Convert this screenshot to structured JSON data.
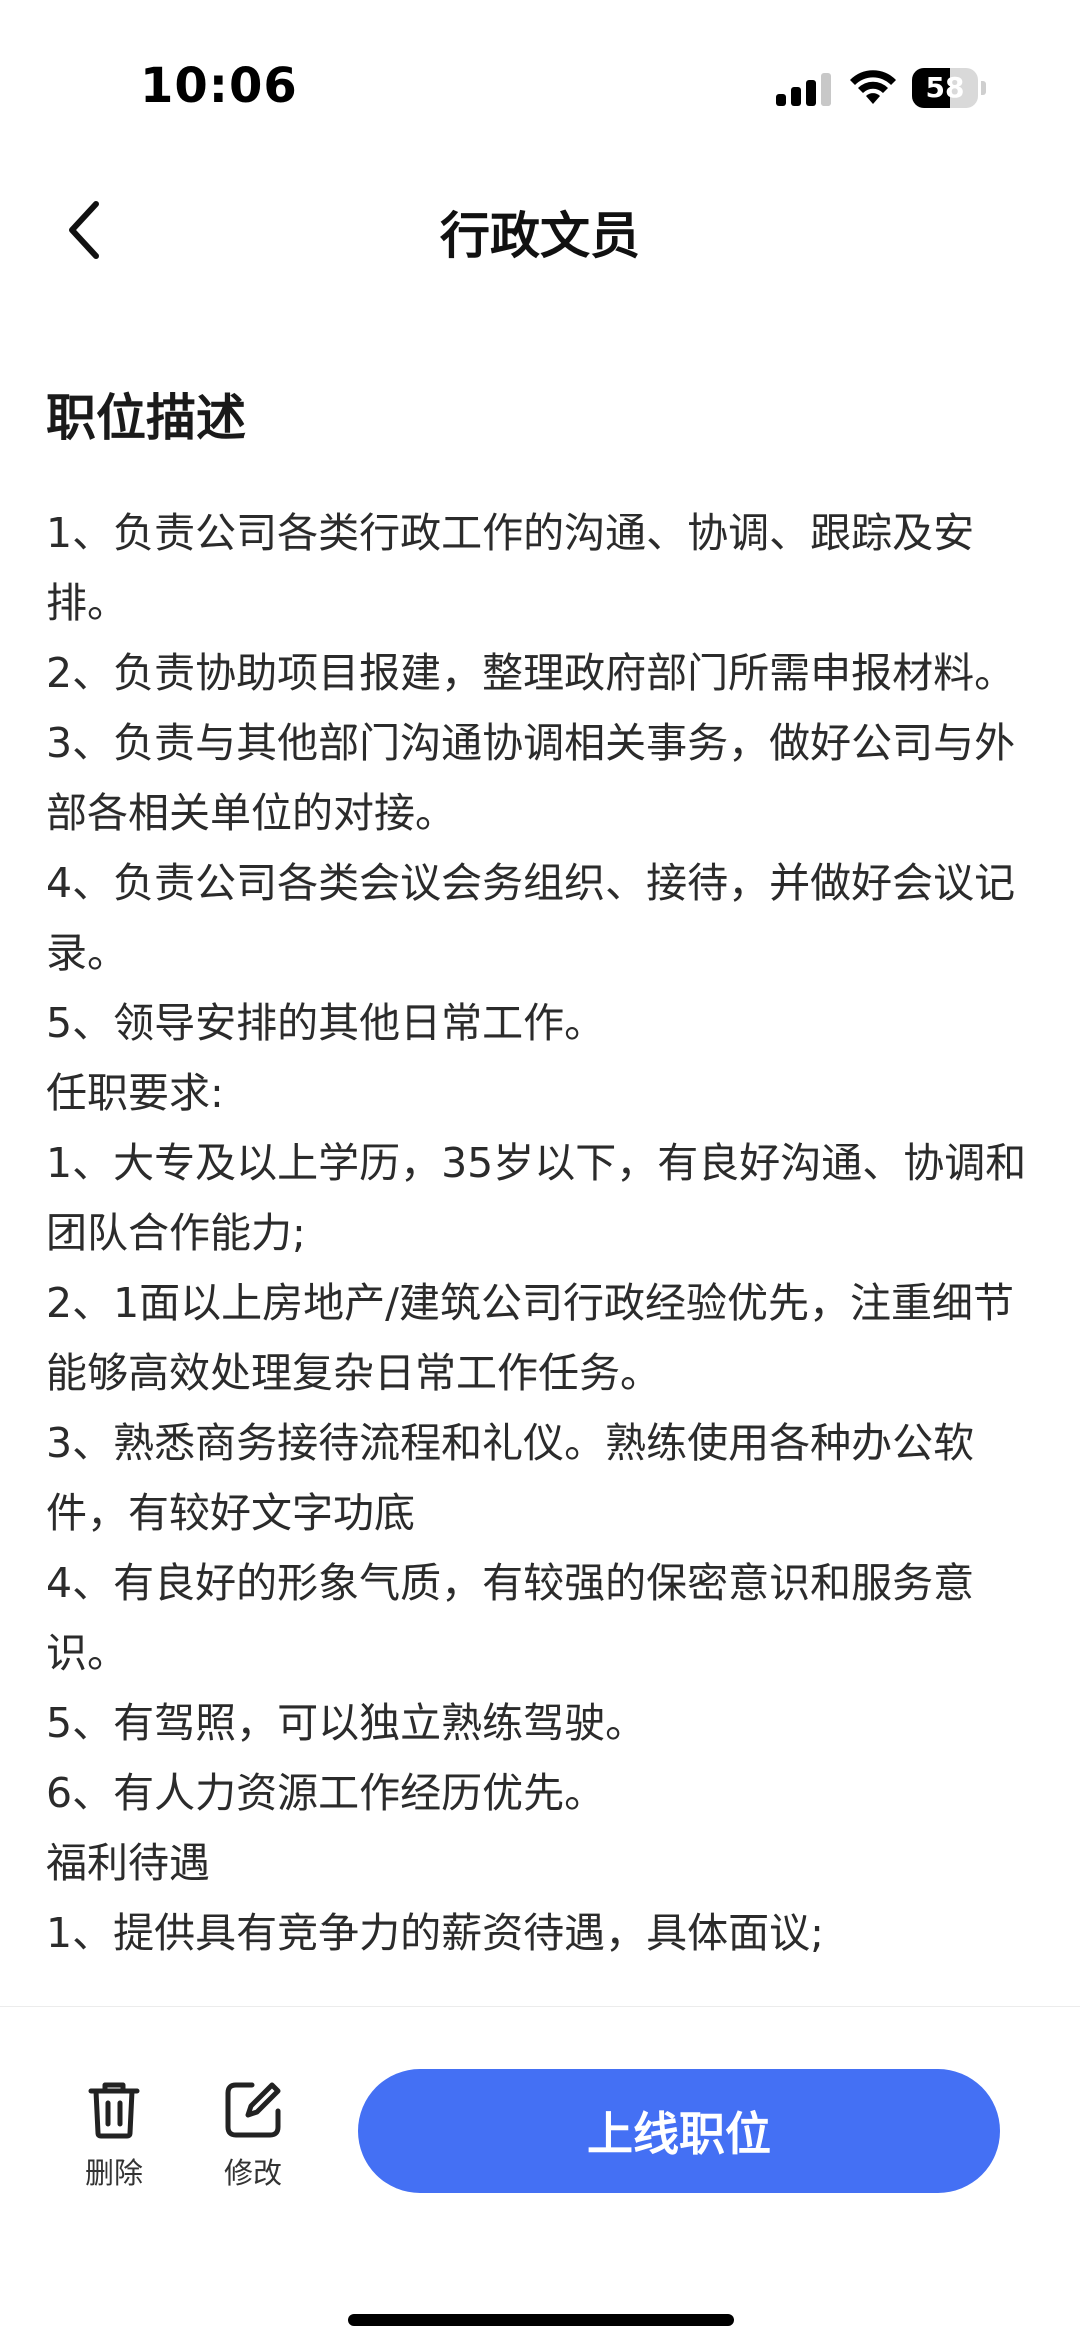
{
  "status_bar": {
    "time": "10:06",
    "battery_level": "58",
    "battery_fraction": 0.58
  },
  "nav": {
    "title": "行政文员",
    "back_icon": "chevron-left-icon"
  },
  "content": {
    "section_heading": "职位描述",
    "lines": [
      "1、负责公司各类行政工作的沟通、协调、跟踪及安排。",
      "2、负责协助项目报建，整理政府部门所需申报材料。",
      "3、负责与其他部门沟通协调相关事务，做好公司与外部各相关单位的对接。",
      "4、负责公司各类会议会务组织、接待，并做好会议记录。",
      "5、领导安排的其他日常工作。",
      "任职要求:",
      "1、大专及以上学历，35岁以下，有良好沟通、协调和团队合作能力;",
      "2、1面以上房地产/建筑公司行政经验优先，注重细节能够高效处理复杂日常工作任务。",
      "3、熟悉商务接待流程和礼仪。熟练使用各种办公软件，有较好文字功底",
      "4、有良好的形象气质，有较强的保密意识和服务意识。",
      "5、有驾照，可以独立熟练驾驶。",
      "6、有人力资源工作经历优先。",
      "福利待遇",
      "1、提供具有竞争力的薪资待遇，具体面议;"
    ]
  },
  "actions": {
    "delete_label": "删除",
    "delete_icon": "trash-icon",
    "edit_label": "修改",
    "edit_icon": "edit-icon",
    "primary_label": "上线职位"
  },
  "colors": {
    "primary": "#4470f4",
    "text": "#2b2b2b",
    "background": "#ffffff"
  }
}
